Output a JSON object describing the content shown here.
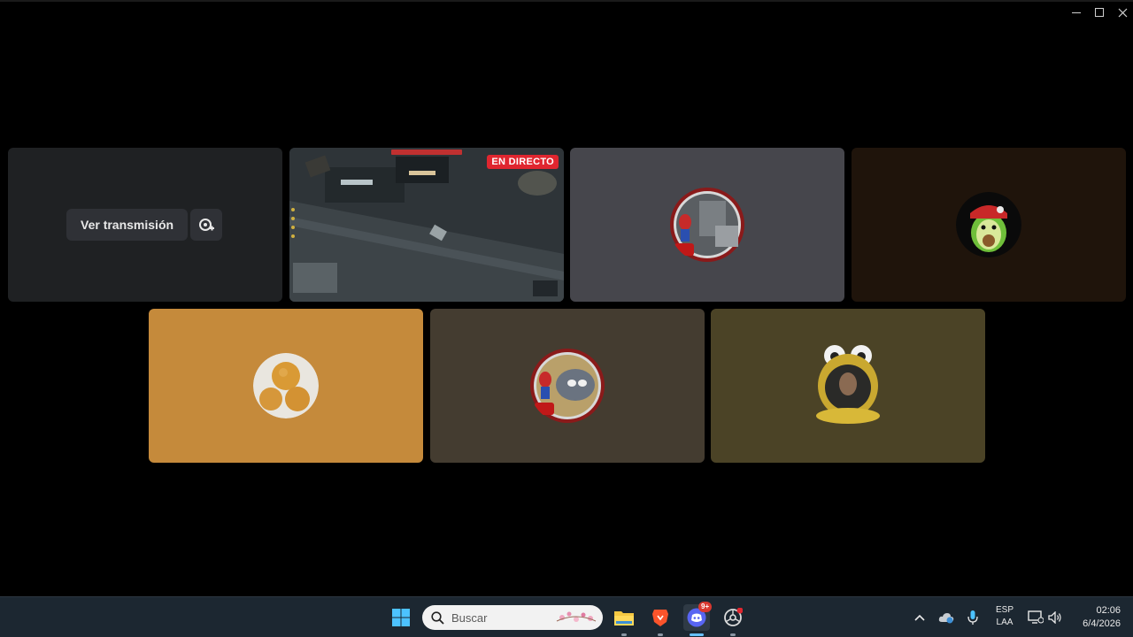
{
  "window": {
    "controls": [
      "minimize",
      "maximize",
      "close"
    ]
  },
  "tiles": {
    "stream_watch": {
      "watch_label": "Ver transmisión",
      "popout_icon": "popout-stream-icon"
    },
    "stream_live": {
      "badge": "EN DIRECTO"
    },
    "participants": [
      {
        "avatar": "spiderman-figure-avatar",
        "bg": "#46464c"
      },
      {
        "avatar": "avocado-cap-avatar",
        "bg": "#1f140b"
      },
      {
        "avatar": "bread-rolls-avatar",
        "bg": "#c58a3b"
      },
      {
        "avatar": "tom-and-spiderman-avatar",
        "bg": "#443c30"
      },
      {
        "avatar": "frog-hood-avatar",
        "bg": "#4b4326"
      }
    ]
  },
  "taskbar": {
    "search_placeholder": "Buscar",
    "discord_badge": "9+",
    "lang_line1": "ESP",
    "lang_line2": "LAA",
    "time": "02:06",
    "date": "6/4/2026"
  },
  "colors": {
    "live_red": "#e0262f",
    "taskbar_bg": "#1c2731",
    "active_indicator": "#67c0ff"
  }
}
